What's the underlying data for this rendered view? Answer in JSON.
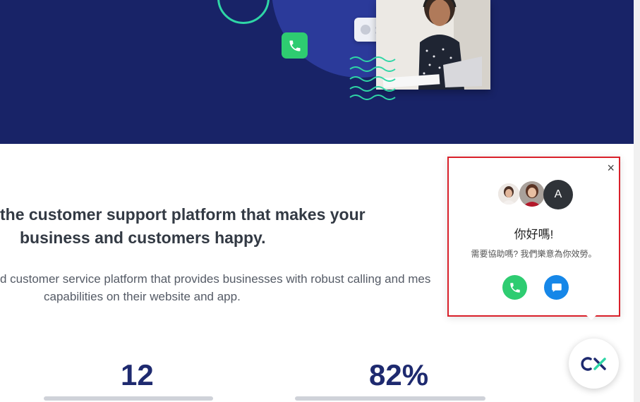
{
  "headline": {
    "line1": "the customer support platform that makes your",
    "line2": "business and customers happy."
  },
  "subtext": {
    "line1": "d customer service platform that provides businesses with robust calling and mes",
    "line2": "capabilities on their website and app."
  },
  "stats": [
    {
      "value": "12"
    },
    {
      "value": "82%"
    }
  ],
  "popup": {
    "close_label": "×",
    "agent_initial": "A",
    "greeting": "你好嗎!",
    "help_text": "需要協助嗎? 我們樂意為你效勞。"
  },
  "colors": {
    "hero_bg": "#182367",
    "accent_green": "#2ecc71",
    "chat_blue": "#1687e8",
    "highlight_red": "#d9202a",
    "launcher_navy": "#1e2a6f",
    "launcher_teal": "#2fd6a6"
  },
  "icons": {
    "popup_call": "phone-icon",
    "popup_chat": "chat-bubble-icon",
    "launcher": "cx-logo-icon",
    "hero_phone": "phone-icon"
  }
}
